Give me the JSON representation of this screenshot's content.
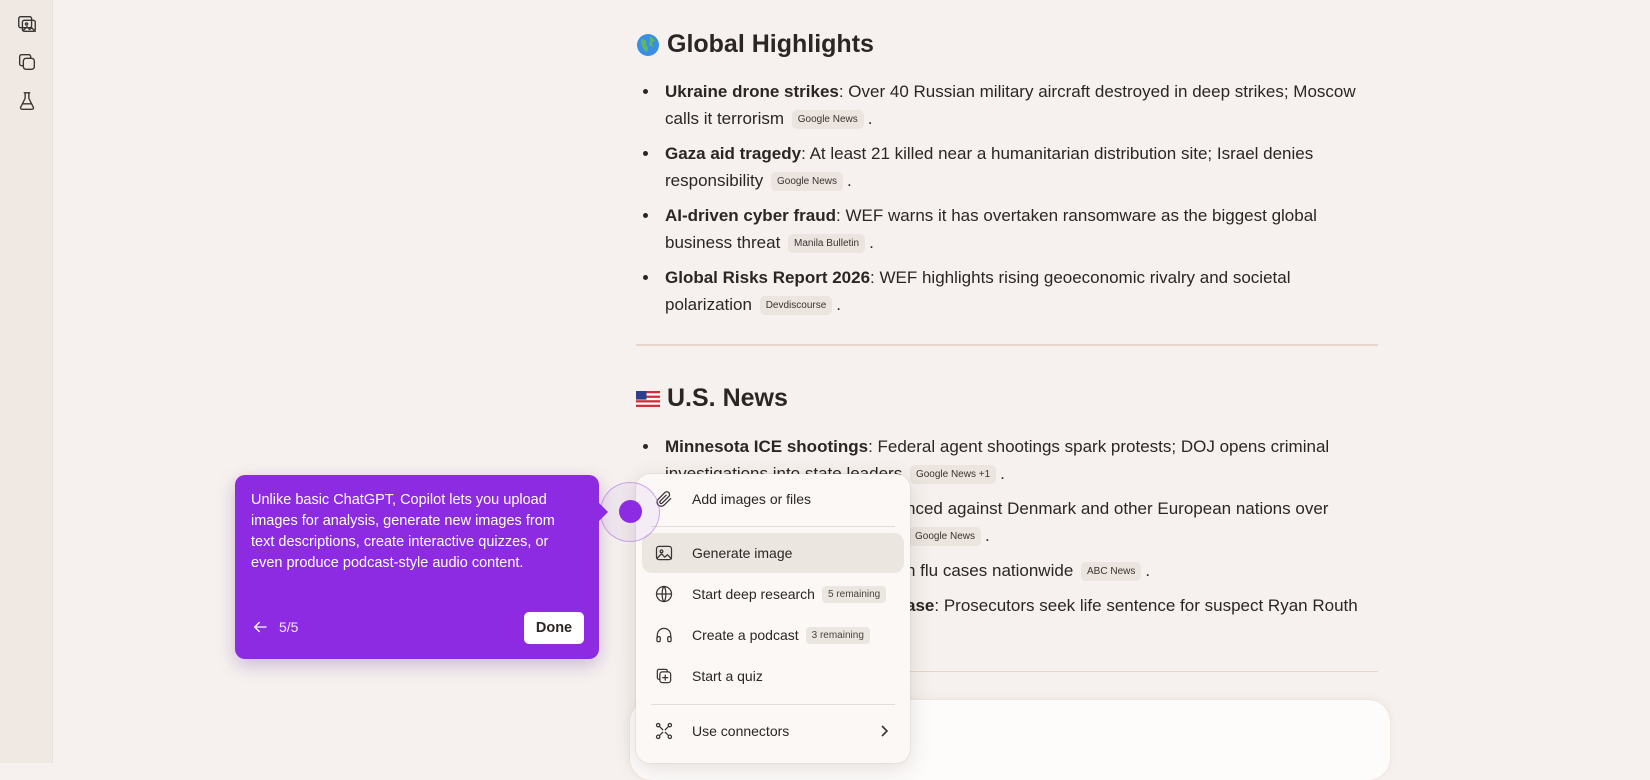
{
  "sidebar": {
    "items": [
      {
        "icon": "gallery-icon"
      },
      {
        "icon": "copy-pages-icon"
      },
      {
        "icon": "flask-icon"
      }
    ]
  },
  "global": {
    "flag": "🌍",
    "title": "Global Highlights",
    "items": [
      {
        "bold": "Ukraine drone strikes",
        "text": ": Over 40 Russian military aircraft destroyed in deep strikes; Moscow calls it terrorism",
        "source": "Google News",
        "end": "."
      },
      {
        "bold": "Gaza aid tragedy",
        "text": ": At least 21 killed near a humanitarian distribution site; Israel denies responsibility",
        "source": "Google News",
        "end": "."
      },
      {
        "bold": "AI-driven cyber fraud",
        "text": ": WEF warns it has overtaken ransomware as the biggest global business threat",
        "source": "Manila Bulletin",
        "end": "."
      },
      {
        "bold": "Global Risks Report 2026",
        "text": ": WEF highlights rising geoeconomic rivalry and societal polarization",
        "source": "Devdiscourse",
        "end": "."
      }
    ]
  },
  "us": {
    "flag": "🇺🇸",
    "title": "U.S. News",
    "items": [
      {
        "bold": "Minnesota ICE shootings",
        "text": ": Federal agent shootings spark protests; DOJ opens criminal investigations into state leaders",
        "source": "Google News +1",
        "end": "."
      },
      {
        "bold": "",
        "text": "nced against Denmark and other European nations over",
        "source": "Google News",
        "end": "."
      },
      {
        "bold": "",
        "text": "n flu cases nationwide",
        "source": "ABC News",
        "end": "."
      },
      {
        "bold": "ase",
        "text": ": Prosecutors seek life sentence for suspect Ryan Routh",
        "source": "",
        "end": ""
      }
    ]
  },
  "menu": {
    "add_files": "Add images or files",
    "generate_image": "Generate image",
    "deep_research": "Start deep research",
    "deep_research_remaining": "5 remaining",
    "podcast": "Create a podcast",
    "podcast_remaining": "3 remaining",
    "quiz": "Start a quiz",
    "connectors": "Use connectors"
  },
  "tooltip": {
    "text": "Unlike basic ChatGPT, Copilot lets you upload images for analysis, generate new images from text descriptions, create interactive quizzes, or even produce podcast-style audio content.",
    "step": "5/5",
    "done_label": "Done"
  },
  "colors": {
    "accent": "#8d2be2",
    "background": "#f6f1ee",
    "sidebar": "#efe8e3"
  }
}
